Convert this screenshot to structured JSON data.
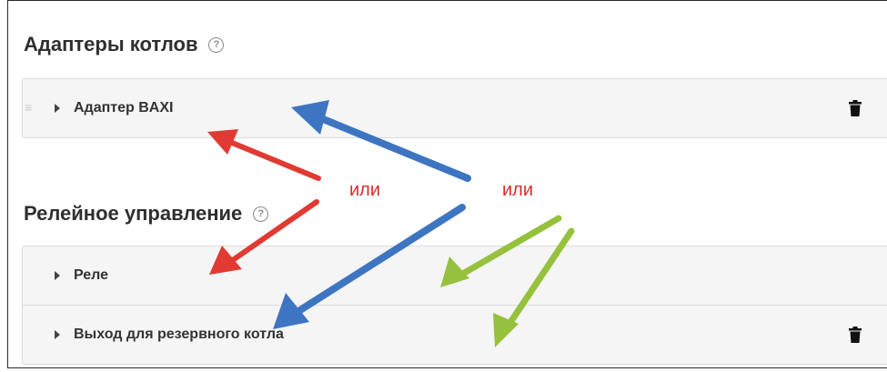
{
  "boiler_adapters": {
    "title": "Адаптеры котлов",
    "help_glyph": "?",
    "items": [
      {
        "label": "Адаптер BAXI",
        "has_delete": true
      }
    ]
  },
  "relay_control": {
    "title": "Релейное управление",
    "help_glyph": "?",
    "items": [
      {
        "label": "Реле",
        "has_delete": false
      },
      {
        "label": "Выход для резервного котла",
        "has_delete": true
      }
    ]
  },
  "annotations": {
    "or_left": "или",
    "or_right": "или",
    "colors": {
      "red": "#e03a32",
      "blue": "#3d75c2",
      "green": "#95c13d"
    }
  }
}
